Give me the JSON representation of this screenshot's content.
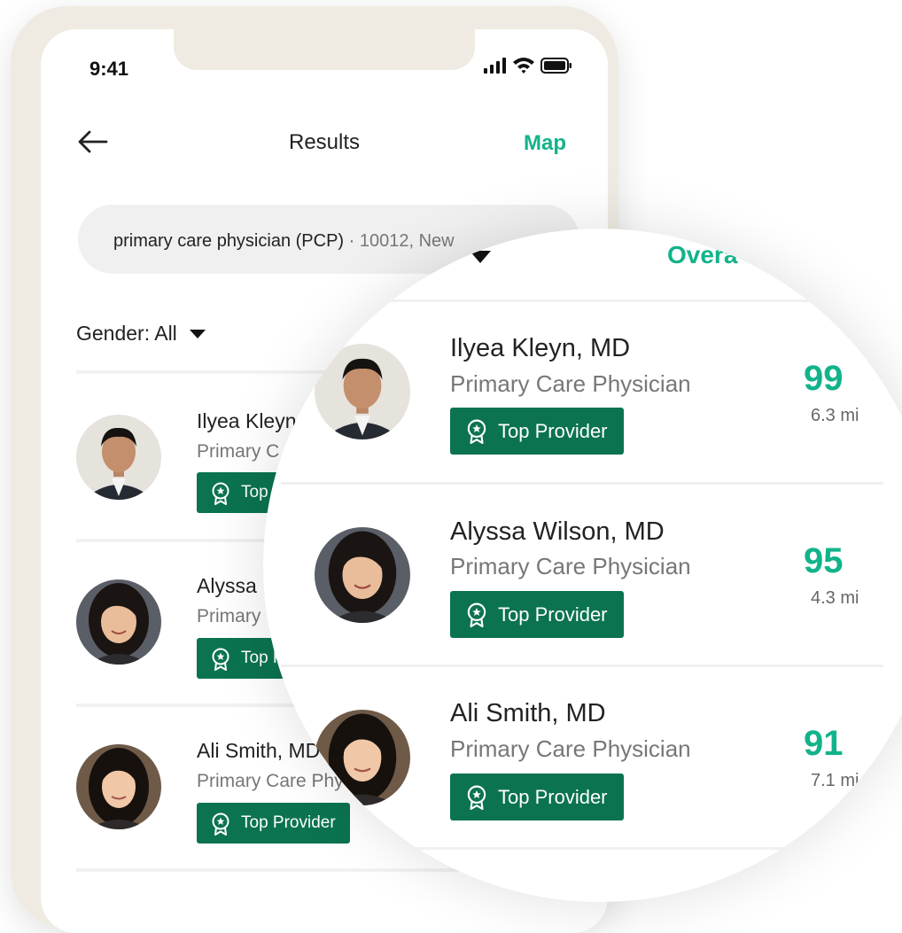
{
  "status_bar": {
    "time": "9:41"
  },
  "header": {
    "title": "Results",
    "map_label": "Map"
  },
  "search": {
    "query": "primary care physician (PCP)",
    "separator": " · ",
    "location": "10012, New"
  },
  "filters": {
    "gender_label": "Gender: All"
  },
  "magnifier": {
    "sort_label": "Overa"
  },
  "providers": [
    {
      "name": "Ilyea Kleyn, MD",
      "name_visible": "Ilyea Kleyn",
      "specialty": "Primary Care Physician",
      "specialty_visible": "Primary C",
      "badge": "Top Provider",
      "badge_visible": "Top P",
      "score": "99",
      "distance": "6.3 mi"
    },
    {
      "name": "Alyssa Wilson, MD",
      "name_visible": "Alyssa",
      "specialty": "Primary Care Physician",
      "specialty_visible": "Primary",
      "badge": "Top Provider",
      "badge_visible": "Top P",
      "score": "95",
      "distance": "4.3 mi"
    },
    {
      "name": "Ali Smith, MD",
      "name_visible": "Ali Smith, MD",
      "specialty": "Primary Care Physician",
      "specialty_visible": "Primary Care Phy",
      "badge": "Top Provider",
      "badge_visible": "Top Provider",
      "score": "91",
      "distance": "7.1 mi"
    }
  ],
  "colors": {
    "accent": "#12b38a",
    "badge_bg": "#0b7350",
    "frame": "#efebe2"
  }
}
